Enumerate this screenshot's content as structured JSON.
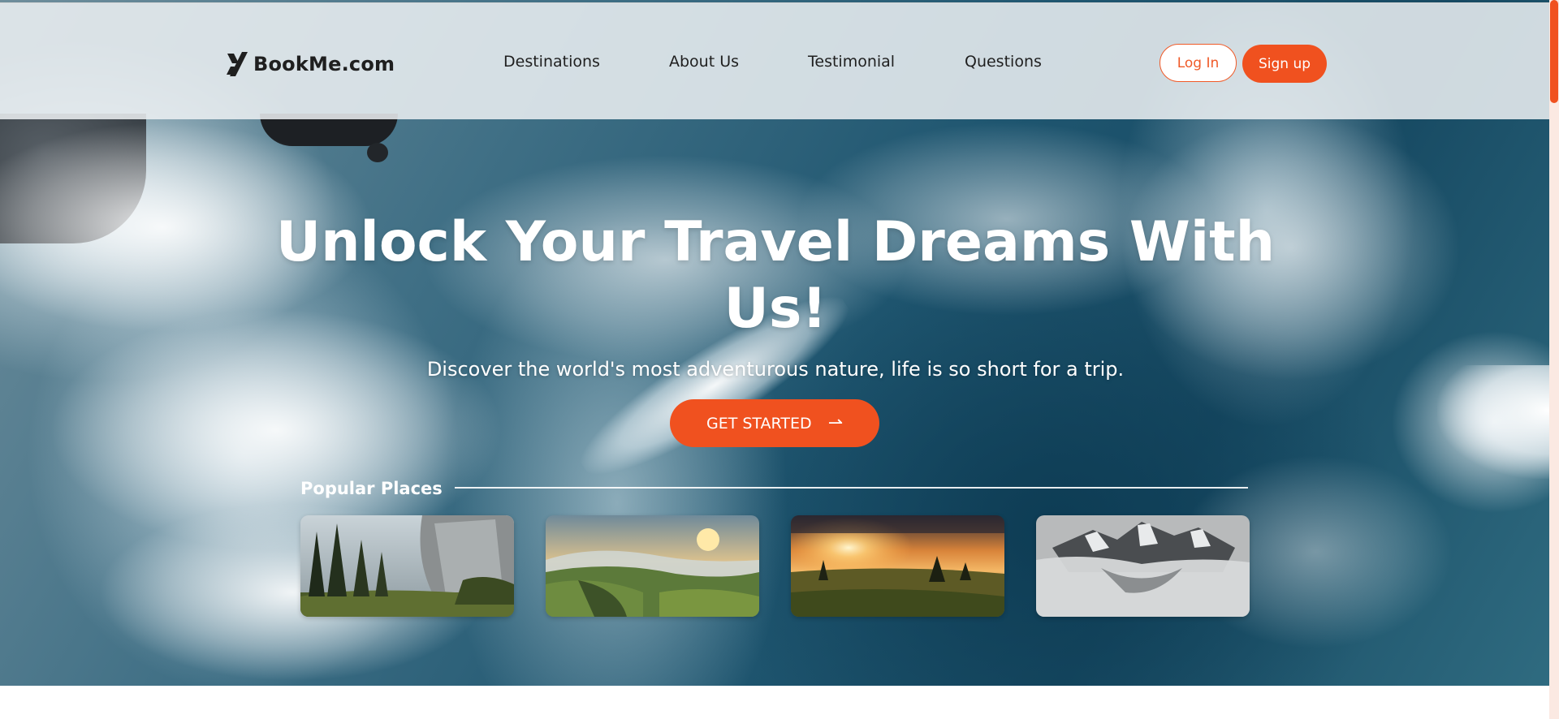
{
  "header": {
    "logo_text": "BookMe.com",
    "logo_icon": "x-logo-icon",
    "nav": [
      {
        "label": "Destinations"
      },
      {
        "label": "About Us"
      },
      {
        "label": "Testimonial"
      },
      {
        "label": "Questions"
      }
    ],
    "login_label": "Log In",
    "signup_label": "Sign up"
  },
  "hero": {
    "title_line1": "Unlock Your Travel Dreams With",
    "title_line2": "Us!",
    "subtitle": "Discover the world's most adventurous nature, life is so short for a trip.",
    "cta_label": "GET STARTED",
    "cta_icon": "arrow-right-icon"
  },
  "popular": {
    "label": "Popular Places",
    "places": [
      {
        "image": "forest-cliff-image"
      },
      {
        "image": "green-hills-sunset-image"
      },
      {
        "image": "sunrise-meadow-image"
      },
      {
        "image": "misty-mountain-image"
      }
    ]
  },
  "colors": {
    "accent": "#f0511f",
    "header_bg": "#eef1f3",
    "text_dark": "#1f1f1f",
    "ocean": "#1f5670"
  }
}
